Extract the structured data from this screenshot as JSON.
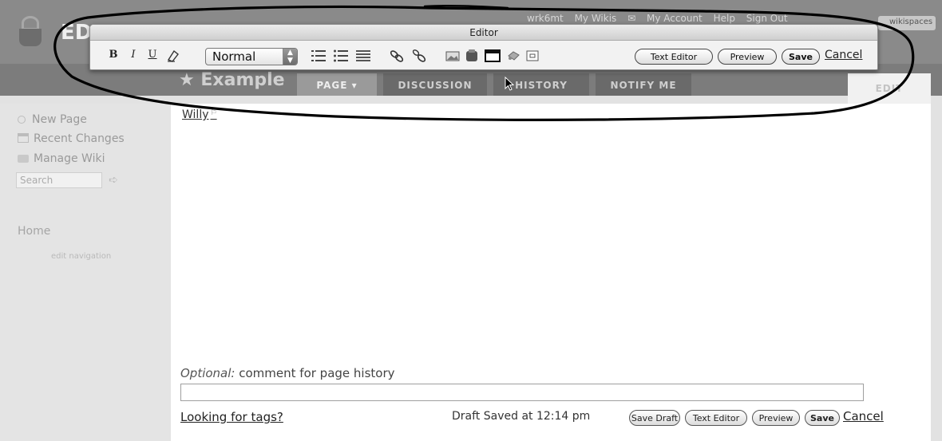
{
  "header": {
    "site_title": "ED",
    "top_links": [
      "wrk6mt",
      "My Wikis",
      "My Account",
      "Help",
      "Sign Out"
    ],
    "workspaces_label": "wikispaces"
  },
  "page": {
    "name": "★ Example",
    "tabs": [
      "PAGE ▾",
      "DISCUSSION",
      "HISTORY",
      "NOTIFY ME"
    ],
    "edit_tab": "EDIT"
  },
  "sidebar": {
    "items": [
      {
        "label": "New Page",
        "icon": "new-page-icon"
      },
      {
        "label": "Recent Changes",
        "icon": "calendar-icon"
      },
      {
        "label": "Manage Wiki",
        "icon": "manage-icon"
      }
    ],
    "search_placeholder": "Search",
    "search_go_icon": "arrow-right-icon",
    "home": "Home",
    "edit_navigation": "edit navigation"
  },
  "editor": {
    "window_title": "Editor",
    "format": {
      "bold": "B",
      "italic": "I",
      "underline": "U",
      "clear_formatting_icon": "clear-format-icon"
    },
    "style_select_value": "Normal",
    "icons": [
      "numbered-list-icon",
      "bulleted-list-icon",
      "horizontal-rule-icon",
      "link-icon",
      "external-link-icon",
      "image-icon",
      "file-icon",
      "widget-icon",
      "plugin-icon",
      "table-icon"
    ],
    "buttons": {
      "text_editor": "Text Editor",
      "preview": "Preview",
      "save": "Save",
      "cancel": "Cancel"
    }
  },
  "content": {
    "body_link": "Willy",
    "comment_label_prefix": "Optional:",
    "comment_label_rest": " comment for page history",
    "comment_value": "",
    "tags_link": "Looking for tags?",
    "draft_status": "Draft Saved at 12:14 pm",
    "buttons": {
      "save_draft": "Save Draft",
      "text_editor": "Text Editor",
      "preview": "Preview",
      "save": "Save",
      "cancel": "Cancel"
    }
  },
  "colors": {
    "header_bg": "#8a8a8a",
    "tab_row_bg": "#7c7c7c",
    "content_bg": "#ffffff",
    "annotation_stroke": "#000000"
  }
}
